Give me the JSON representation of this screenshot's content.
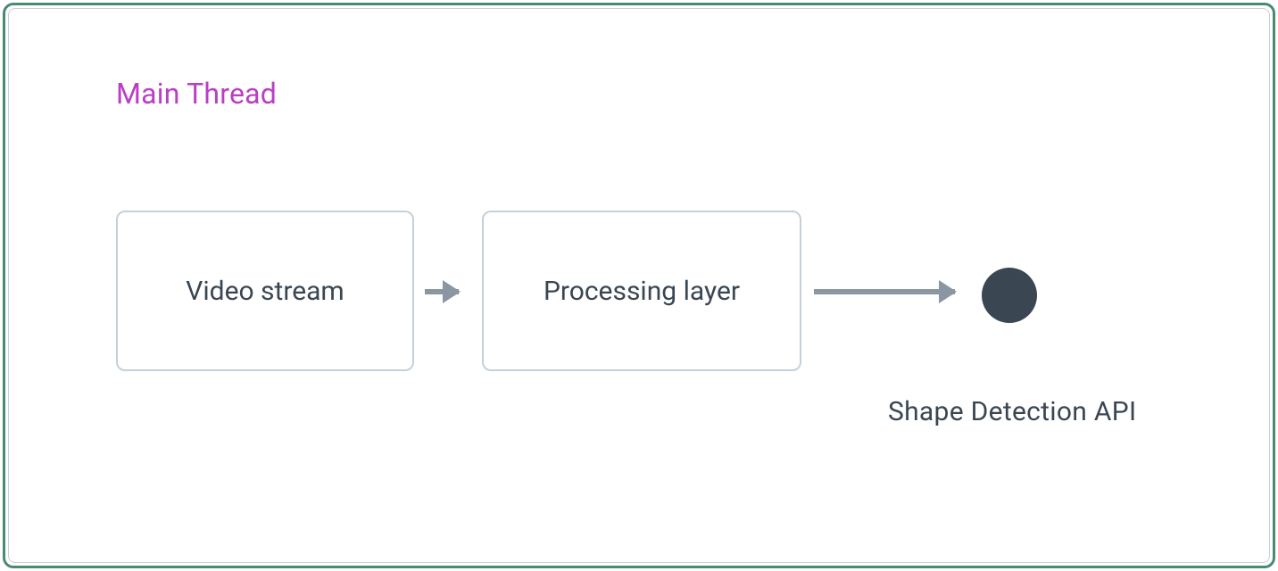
{
  "diagram": {
    "thread_title": "Main Thread",
    "nodes": {
      "video_stream": "Video stream",
      "processing_layer": "Processing layer"
    },
    "endpoint": {
      "label": "Shape Detection API"
    }
  },
  "colors": {
    "frame_outer": "#4a8a6f",
    "frame_inner": "#c4d0db",
    "title": "#b93fc4",
    "node_border": "#c4d0db",
    "text": "#3a4652",
    "dot": "#3a4652",
    "arrow": "#8a96a2"
  }
}
